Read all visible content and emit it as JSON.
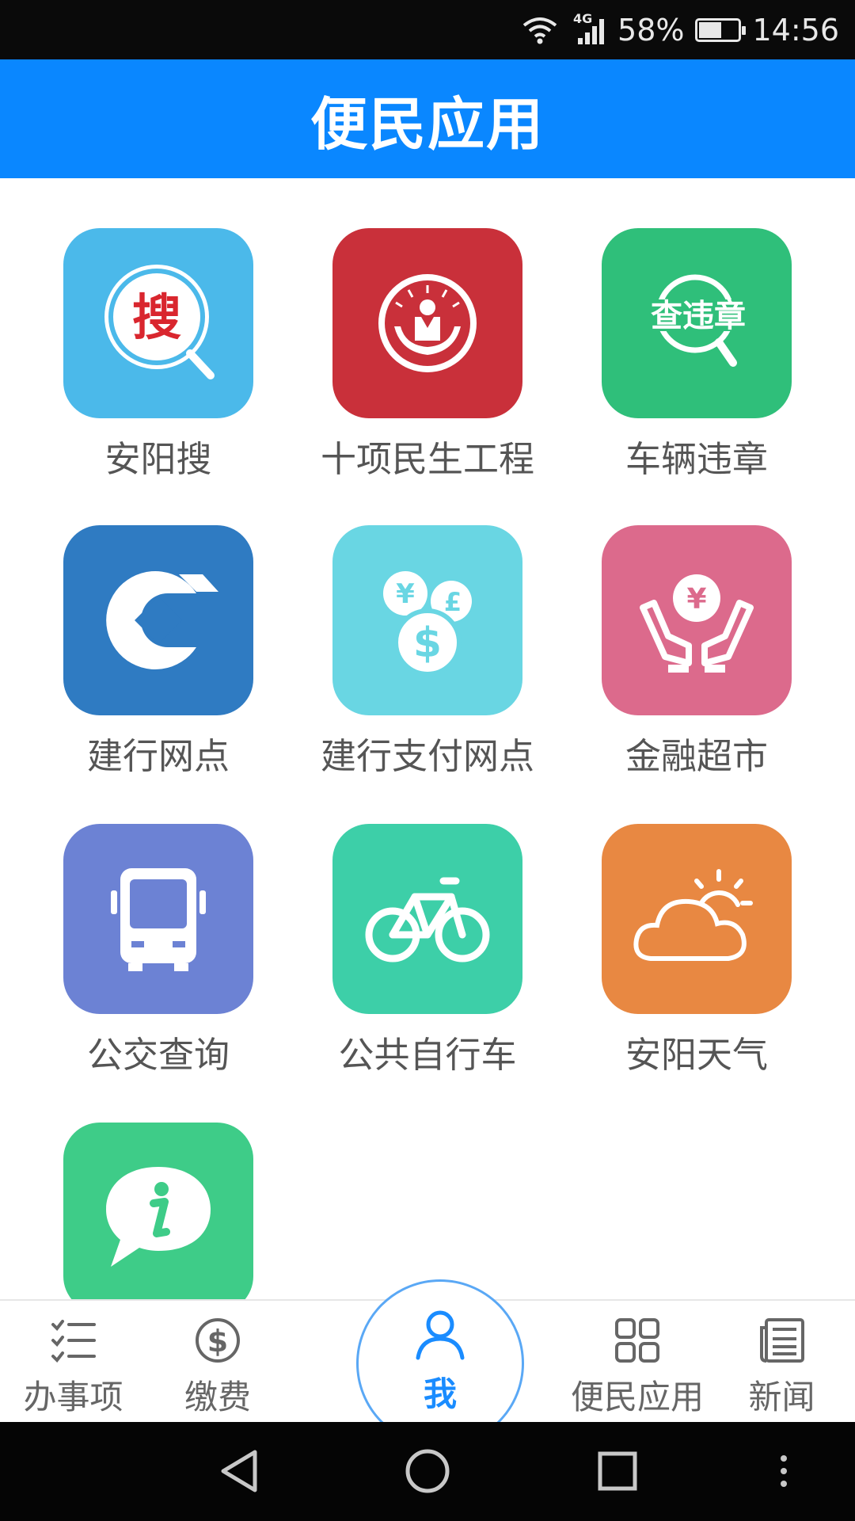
{
  "status_bar": {
    "network": "4G",
    "battery": "58%",
    "battery_level": 0.58,
    "time": "14:56"
  },
  "header": {
    "title": "便民应用"
  },
  "apps": [
    {
      "label": "安阳搜",
      "icon": "search-icon",
      "color": "#4bb9ea"
    },
    {
      "label": "十项民生工程",
      "icon": "livelihood-emblem-icon",
      "color": "#c9303a"
    },
    {
      "label": "车辆违章",
      "icon": "traffic-violation-icon",
      "color": "#2fbf7a"
    },
    {
      "label": "建行网点",
      "icon": "ccb-logo-icon",
      "color": "#2f7bc2"
    },
    {
      "label": "建行支付网点",
      "icon": "currency-coins-icon",
      "color": "#69d6e3"
    },
    {
      "label": "金融超市",
      "icon": "yuan-hands-icon",
      "color": "#dc6a8c"
    },
    {
      "label": "公交查询",
      "icon": "bus-icon",
      "color": "#6c82d4"
    },
    {
      "label": "公共自行车",
      "icon": "bicycle-icon",
      "color": "#3dcfa8"
    },
    {
      "label": "安阳天气",
      "icon": "weather-cloud-sun-icon",
      "color": "#e88842"
    },
    {
      "label": "",
      "icon": "info-bubble-icon",
      "color": "#3ecc88"
    }
  ],
  "app_icon_text": {
    "search": "搜",
    "violation": "查违章"
  },
  "bottom_nav": {
    "items": [
      {
        "label": "办事项",
        "icon": "checklist-icon"
      },
      {
        "label": "缴费",
        "icon": "dollar-circle-icon"
      },
      {
        "label": "我",
        "icon": "person-icon",
        "active": true
      },
      {
        "label": "便民应用",
        "icon": "grid-apps-icon"
      },
      {
        "label": "新闻",
        "icon": "newspaper-icon"
      }
    ],
    "active_color": "#1a8cff"
  },
  "system_nav": [
    "back-icon",
    "home-icon",
    "recents-icon",
    "more-icon"
  ]
}
